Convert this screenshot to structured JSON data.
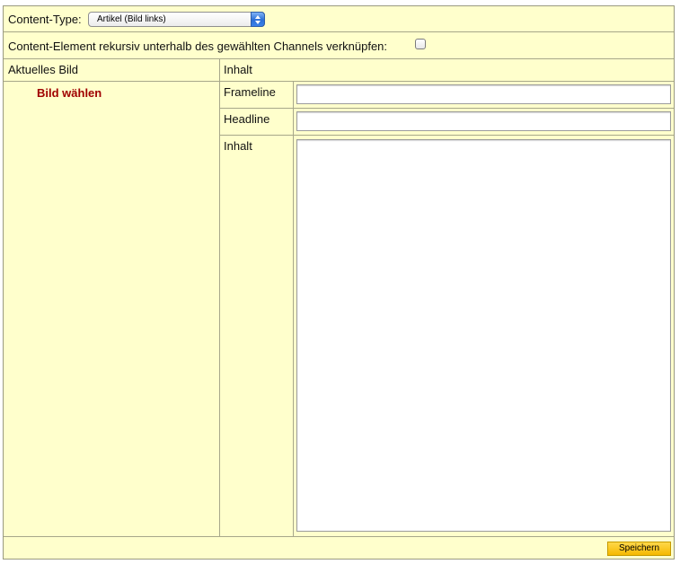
{
  "form": {
    "content_type_label": "Content-Type:",
    "content_type_value": "Artikel (Bild links)",
    "recursive_label": "Content-Element rekursiv unterhalb des gewählten Channels verknüpfen:",
    "recursive_checked": false
  },
  "columns": {
    "left_header": "Aktuelles Bild",
    "right_header": "Inhalt"
  },
  "image": {
    "pick_label": "Bild wählen"
  },
  "fields": {
    "frameline_label": "Frameline",
    "frameline_value": "",
    "headline_label": "Headline",
    "headline_value": "",
    "content_label": "Inhalt",
    "content_value": ""
  },
  "actions": {
    "save_label": "Speichern"
  },
  "colors": {
    "background": "#ffffcc",
    "link": "#a00000",
    "button": "#f5b800"
  }
}
